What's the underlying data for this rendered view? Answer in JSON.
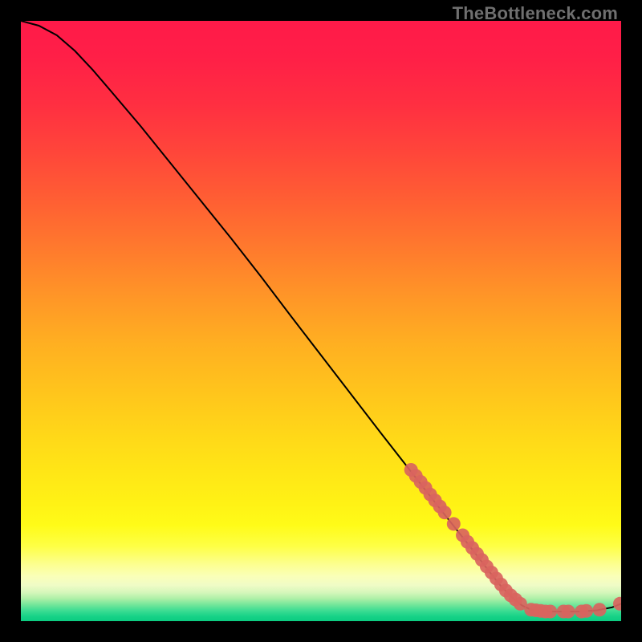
{
  "watermark": "TheBottleneck.com",
  "gradient_stops": [
    {
      "offset": 0.0,
      "color": "#ff1a49"
    },
    {
      "offset": 0.06,
      "color": "#ff1f47"
    },
    {
      "offset": 0.14,
      "color": "#ff2f41"
    },
    {
      "offset": 0.22,
      "color": "#ff463a"
    },
    {
      "offset": 0.3,
      "color": "#ff5f33"
    },
    {
      "offset": 0.38,
      "color": "#ff7a2d"
    },
    {
      "offset": 0.46,
      "color": "#ff9627"
    },
    {
      "offset": 0.54,
      "color": "#ffb021"
    },
    {
      "offset": 0.62,
      "color": "#ffc51c"
    },
    {
      "offset": 0.7,
      "color": "#ffda18"
    },
    {
      "offset": 0.76,
      "color": "#ffe816"
    },
    {
      "offset": 0.805,
      "color": "#fff215"
    },
    {
      "offset": 0.84,
      "color": "#fffb18"
    },
    {
      "offset": 0.875,
      "color": "#feff45"
    },
    {
      "offset": 0.905,
      "color": "#fcff8f"
    },
    {
      "offset": 0.925,
      "color": "#faffb8"
    },
    {
      "offset": 0.94,
      "color": "#f0fcc6"
    },
    {
      "offset": 0.952,
      "color": "#d6f7bb"
    },
    {
      "offset": 0.962,
      "color": "#b0f0a8"
    },
    {
      "offset": 0.972,
      "color": "#77e79b"
    },
    {
      "offset": 0.982,
      "color": "#3fdd93"
    },
    {
      "offset": 0.992,
      "color": "#17d287"
    },
    {
      "offset": 1.0,
      "color": "#0bcc80"
    }
  ],
  "chart_data": {
    "type": "line",
    "title": "",
    "xlabel": "",
    "ylabel": "",
    "xlim": [
      0,
      100
    ],
    "ylim": [
      0,
      100
    ],
    "grid": false,
    "series": [
      {
        "name": "curve",
        "color": "#000000",
        "points": [
          {
            "x": 0.0,
            "y": 100.0
          },
          {
            "x": 3.0,
            "y": 99.2
          },
          {
            "x": 6.0,
            "y": 97.6
          },
          {
            "x": 9.0,
            "y": 95.0
          },
          {
            "x": 12.0,
            "y": 91.8
          },
          {
            "x": 15.0,
            "y": 88.3
          },
          {
            "x": 20.0,
            "y": 82.4
          },
          {
            "x": 25.0,
            "y": 76.2
          },
          {
            "x": 30.0,
            "y": 70.0
          },
          {
            "x": 35.0,
            "y": 63.8
          },
          {
            "x": 40.0,
            "y": 57.4
          },
          {
            "x": 45.0,
            "y": 50.8
          },
          {
            "x": 50.0,
            "y": 44.3
          },
          {
            "x": 55.0,
            "y": 37.8
          },
          {
            "x": 60.0,
            "y": 31.3
          },
          {
            "x": 65.0,
            "y": 24.9
          },
          {
            "x": 70.0,
            "y": 18.5
          },
          {
            "x": 75.0,
            "y": 12.2
          },
          {
            "x": 78.0,
            "y": 8.3
          },
          {
            "x": 80.0,
            "y": 5.8
          },
          {
            "x": 82.0,
            "y": 3.8
          },
          {
            "x": 83.5,
            "y": 2.6
          },
          {
            "x": 85.0,
            "y": 1.9
          },
          {
            "x": 87.0,
            "y": 1.6
          },
          {
            "x": 90.0,
            "y": 1.6
          },
          {
            "x": 93.0,
            "y": 1.6
          },
          {
            "x": 96.0,
            "y": 1.8
          },
          {
            "x": 98.5,
            "y": 2.3
          },
          {
            "x": 100.0,
            "y": 2.9
          }
        ]
      },
      {
        "name": "markers",
        "color": "#d9645e",
        "marker_radius": 8.5,
        "points": [
          {
            "x": 65.0,
            "y": 25.2
          },
          {
            "x": 65.8,
            "y": 24.2
          },
          {
            "x": 66.6,
            "y": 23.2
          },
          {
            "x": 67.4,
            "y": 22.2
          },
          {
            "x": 68.2,
            "y": 21.1
          },
          {
            "x": 69.0,
            "y": 20.1
          },
          {
            "x": 69.8,
            "y": 19.1
          },
          {
            "x": 70.6,
            "y": 18.1
          },
          {
            "x": 72.1,
            "y": 16.2
          },
          {
            "x": 73.6,
            "y": 14.3
          },
          {
            "x": 74.4,
            "y": 13.2
          },
          {
            "x": 75.2,
            "y": 12.2
          },
          {
            "x": 76.0,
            "y": 11.2
          },
          {
            "x": 76.8,
            "y": 10.2
          },
          {
            "x": 77.6,
            "y": 9.1
          },
          {
            "x": 78.4,
            "y": 8.1
          },
          {
            "x": 79.2,
            "y": 7.1
          },
          {
            "x": 80.0,
            "y": 6.1
          },
          {
            "x": 80.8,
            "y": 5.1
          },
          {
            "x": 81.6,
            "y": 4.3
          },
          {
            "x": 82.4,
            "y": 3.6
          },
          {
            "x": 83.2,
            "y": 2.9
          },
          {
            "x": 85.0,
            "y": 1.9
          },
          {
            "x": 85.8,
            "y": 1.8
          },
          {
            "x": 86.6,
            "y": 1.7
          },
          {
            "x": 87.4,
            "y": 1.6
          },
          {
            "x": 88.2,
            "y": 1.6
          },
          {
            "x": 90.4,
            "y": 1.6
          },
          {
            "x": 91.2,
            "y": 1.6
          },
          {
            "x": 93.4,
            "y": 1.6
          },
          {
            "x": 94.2,
            "y": 1.7
          },
          {
            "x": 96.4,
            "y": 1.9
          },
          {
            "x": 99.8,
            "y": 2.9
          }
        ]
      }
    ]
  }
}
